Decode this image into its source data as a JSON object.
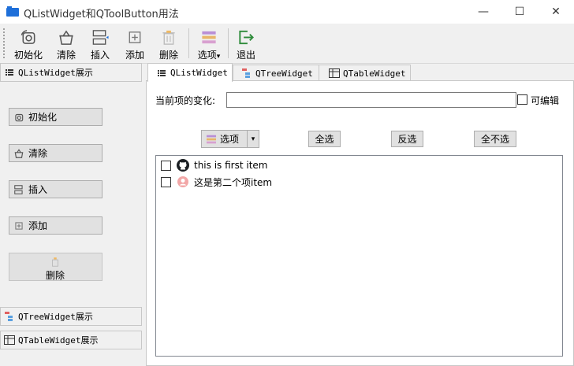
{
  "window": {
    "title": "QListWidget和QToolButton用法",
    "minimize_glyph": "—",
    "maximize_glyph": "☐",
    "close_glyph": "✕"
  },
  "toolbar": {
    "items": [
      {
        "label": "初始化",
        "icon": "init-icon"
      },
      {
        "label": "清除",
        "icon": "basket-icon"
      },
      {
        "label": "插入",
        "icon": "insert-icon"
      },
      {
        "label": "添加",
        "icon": "add-icon"
      },
      {
        "label": "删除",
        "icon": "trash-icon"
      },
      {
        "label": "选项",
        "icon": "options-icon"
      },
      {
        "label": "退出",
        "icon": "exit-icon"
      }
    ],
    "options_dropdown_glyph": "▾"
  },
  "left_panel": {
    "header_list": "QListWidget展示",
    "buttons": [
      {
        "label": "初始化"
      },
      {
        "label": "清除"
      },
      {
        "label": "插入"
      },
      {
        "label": "添加"
      }
    ],
    "delete_label": "删除",
    "header_tree": "QTreeWidget展示",
    "header_table": "QTableWidget展示"
  },
  "tabs": [
    {
      "label": "QListWidget",
      "active": true
    },
    {
      "label": "QTreeWidget",
      "active": false
    },
    {
      "label": "QTableWidget",
      "active": false
    }
  ],
  "list_tab": {
    "change_label": "当前项的变化:",
    "change_value": "",
    "editable_label": "可编辑",
    "editable_checked": false,
    "options_label": "选项",
    "options_arrow": "▾",
    "select_all": "全选",
    "invert_select": "反选",
    "select_none": "全不选",
    "items": [
      {
        "text": "this is first item",
        "checked": false,
        "icon": "github-icon"
      },
      {
        "text": "这是第二个项item",
        "checked": false,
        "icon": "user-badge-icon"
      }
    ]
  },
  "colors": {
    "accent_blue": "#1e6fd9",
    "exit_green": "#2e8b3a",
    "options_purple": "#8e6fc8",
    "badge_red": "#e05a5a"
  }
}
